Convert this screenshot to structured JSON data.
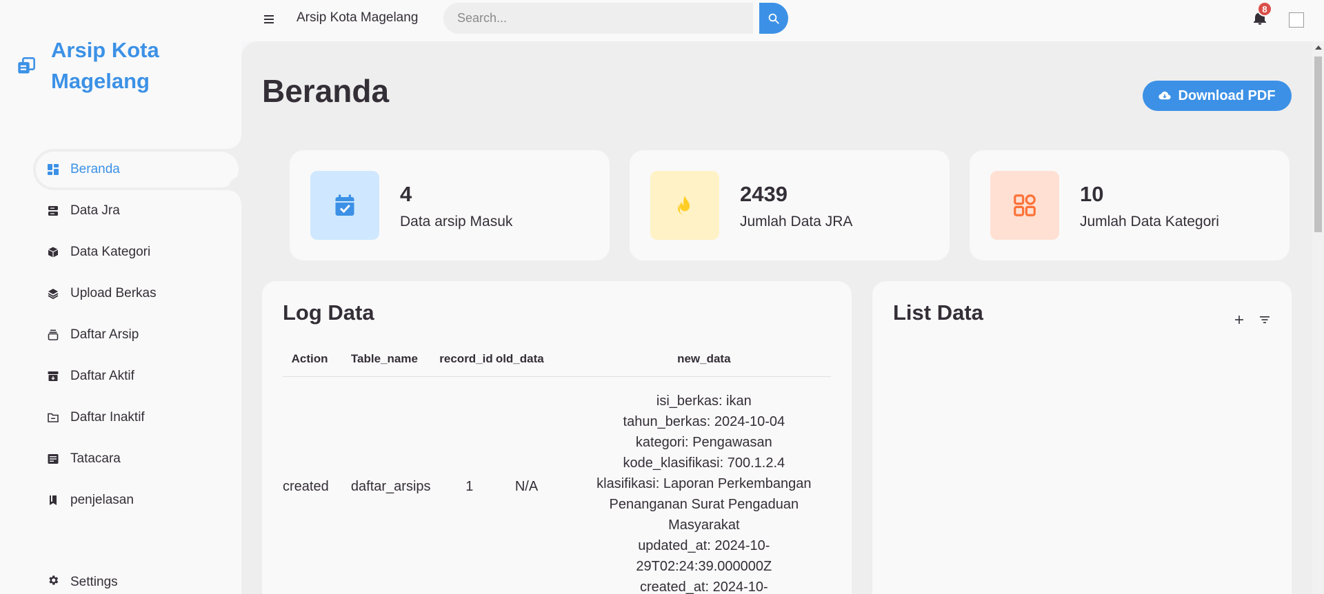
{
  "sidebar": {
    "brand": "Arsip Kota Magelang",
    "items": [
      {
        "label": "Beranda",
        "icon": "dashboard-icon",
        "active": true
      },
      {
        "label": "Data Jra",
        "icon": "server-icon"
      },
      {
        "label": "Data Kategori",
        "icon": "package-icon"
      },
      {
        "label": "Upload Berkas",
        "icon": "layers-icon"
      },
      {
        "label": "Daftar Arsip",
        "icon": "stack-icon"
      },
      {
        "label": "Daftar Aktif",
        "icon": "archive-icon"
      },
      {
        "label": "Daftar Inaktif",
        "icon": "folder-icon"
      },
      {
        "label": "Tatacara",
        "icon": "message-icon"
      },
      {
        "label": "penjelasan",
        "icon": "book-icon"
      }
    ],
    "settings": "Settings"
  },
  "topbar": {
    "title": "Arsip Kota Magelang",
    "search_placeholder": "Search...",
    "notification_count": "8"
  },
  "main": {
    "title": "Beranda",
    "download_label": "Download PDF",
    "stats": [
      {
        "value": "4",
        "label": "Data arsip Masuk",
        "icon": "calendar-check-icon",
        "bg": "#cfe8ff",
        "color": "#3c91e6"
      },
      {
        "value": "2439",
        "label": "Jumlah Data JRA",
        "icon": "fire-icon",
        "bg": "#fff2c6",
        "color": "#ffce26"
      },
      {
        "value": "10",
        "label": "Jumlah Data Kategori",
        "icon": "category-icon",
        "bg": "#ffe0d3",
        "color": "#fd7238"
      }
    ],
    "log": {
      "title": "Log Data",
      "headers": [
        "Action",
        "Table_name",
        "record_id",
        "old_data",
        "new_data"
      ],
      "rows": [
        {
          "action": "created",
          "table_name": "daftar_arsips",
          "record_id": "1",
          "old_data": "N/A",
          "new_data": "isi_berkas: ikan\ntahun_berkas: 2024-10-04\nkategori: Pengawasan\nkode_klasifikasi: 700.1.2.4\nklasifikasi: Laporan Perkembangan Penanganan Surat Pengaduan Masyarakat\nupdated_at: 2024-10-29T02:24:39.000000Z\ncreated_at: 2024-10-"
        }
      ]
    },
    "list": {
      "title": "List Data"
    }
  },
  "colors": {
    "accent": "#3c91e6",
    "danger": "#db504a"
  }
}
